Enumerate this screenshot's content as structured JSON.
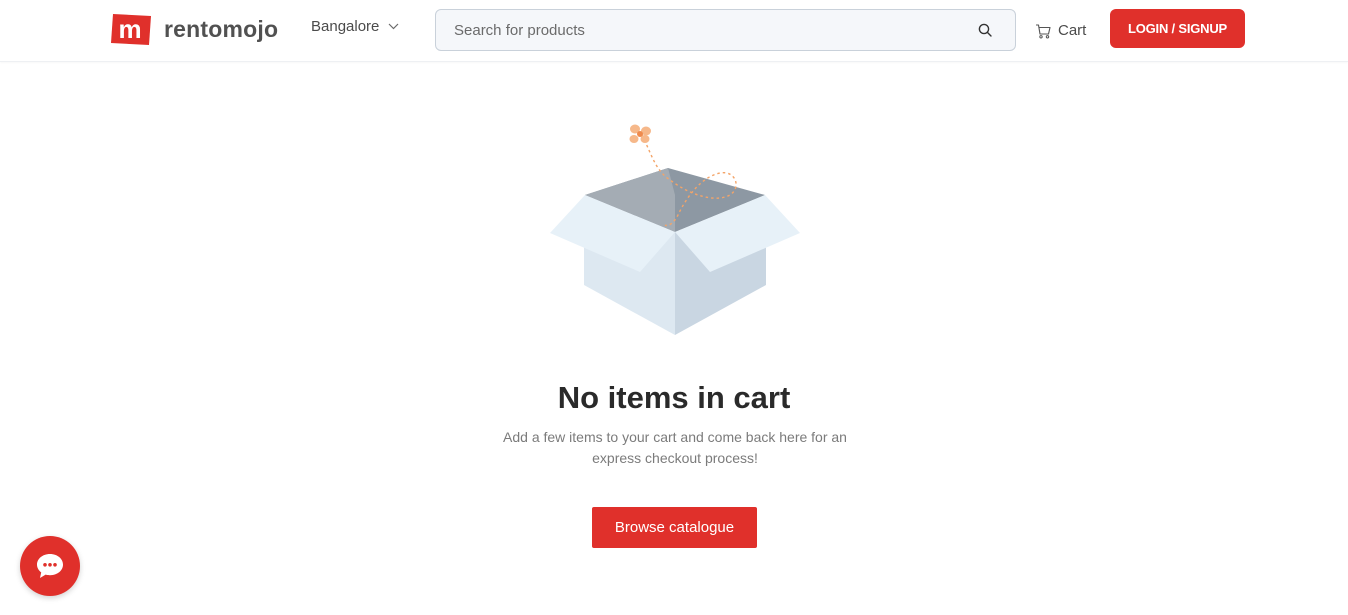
{
  "brand": {
    "name": "rentomojo",
    "accent_color": "#e0302b"
  },
  "header": {
    "city": "Bangalore",
    "city_icon": "chevron-down-icon",
    "search": {
      "placeholder": "Search for products",
      "value": "",
      "icon": "search-icon"
    },
    "cart_label": "Cart",
    "cart_icon": "cart-icon",
    "login_label": "LOGIN / SIGNUP"
  },
  "main": {
    "illustration": "empty-box-illustration",
    "title": "No items in cart",
    "subtitle": "Add a few items to your cart and come back here for an express checkout process!",
    "cta_label": "Browse catalogue"
  },
  "chat": {
    "icon": "chat-bubble-icon"
  }
}
